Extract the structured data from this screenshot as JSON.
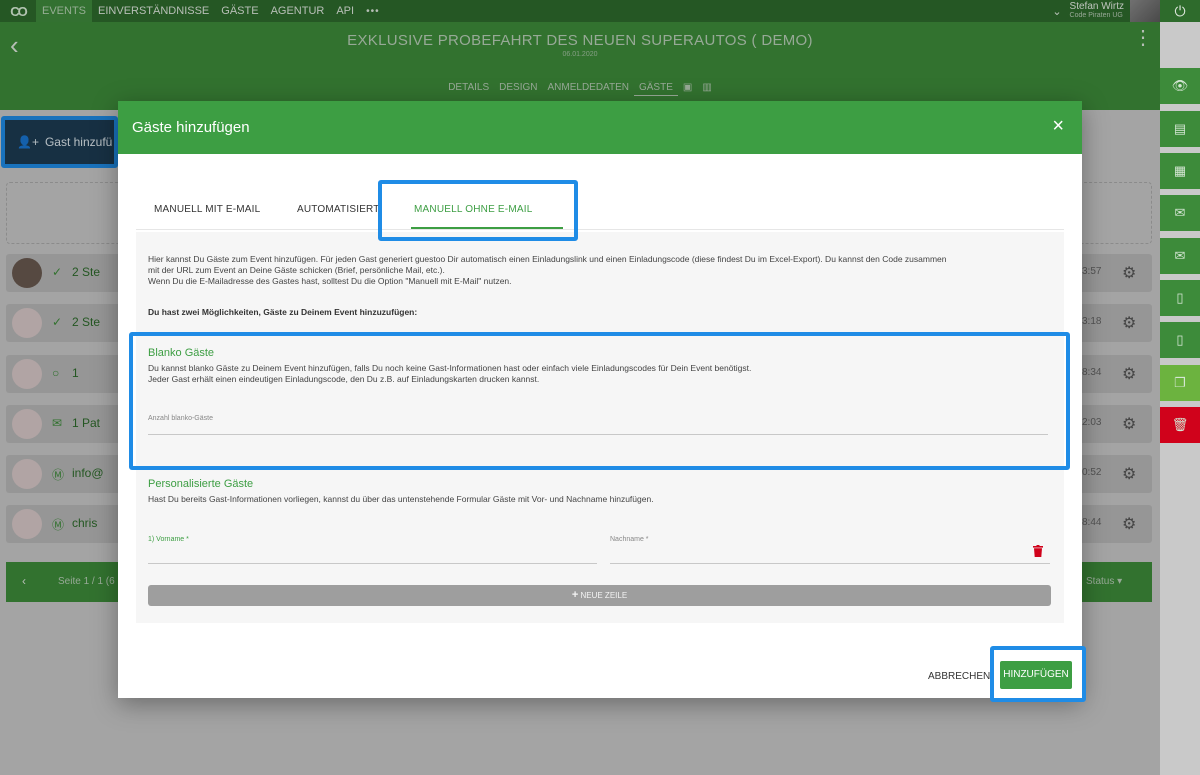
{
  "topnav": {
    "logo": "CO",
    "items": [
      "EVENTS",
      "EINVERSTÄNDNISSE",
      "GÄSTE",
      "AGENTUR",
      "API"
    ],
    "more": "•••",
    "user_name": "Stefan Wirtz",
    "user_company": "Code Piraten UG",
    "power": "⏻"
  },
  "header": {
    "title": "EXKLUSIVE PROBEFAHRT DES NEUEN SUPERAUTOS ( DEMO)",
    "date": "06.01.2020",
    "subnav": [
      "DETAILS",
      "DESIGN",
      "ANMELDEDATEN",
      "GÄSTE"
    ]
  },
  "background": {
    "add_guest_label": "Gast hinzufü",
    "rows": [
      {
        "status": "✓",
        "guests": "2 Ste",
        "time": "3:57"
      },
      {
        "status": "✓",
        "guests": "2 Ste",
        "time": "3:18"
      },
      {
        "status": "○",
        "guests": "1",
        "time": "8:34"
      },
      {
        "status": "✉",
        "guests": "1 Pat",
        "time": "2:03"
      },
      {
        "status": "Ⓜ",
        "guests": "info@",
        "time": "0:52"
      },
      {
        "status": "Ⓜ",
        "guests": "chris",
        "time": "8:44"
      }
    ],
    "pager_text": "Seite 1 / 1 (6",
    "status_label": "Status"
  },
  "modal": {
    "title": "Gäste hinzufügen",
    "close": "×",
    "tabs": [
      "MANUELL MIT E-MAIL",
      "AUTOMATISIERT",
      "MANUELL OHNE E-MAIL"
    ],
    "active_tab": 2,
    "intro_lines": [
      "Hier kannst Du Gäste zum Event hinzufügen. Für jeden Gast generiert guestoo Dir automatisch einen Einladungslink und einen Einladungscode (diese findest Du im Excel-Export). Du kannst den Code zusammen",
      "mit der URL zum Event an Deine Gäste schicken (Brief, persönliche Mail, etc.).",
      "Wenn Du die E-Mailadresse des Gastes hast, solltest Du die Option \"Manuell mit E-Mail\" nutzen."
    ],
    "intro_bold": "Du hast zwei Möglichkeiten, Gäste zu Deinem Event hinzuzufügen:",
    "blank": {
      "title": "Blanko Gäste",
      "desc_lines": [
        "Du kannst blanko Gäste zu Deinem Event hinzufügen, falls Du noch keine Gast-Informationen hast oder einfach viele Einladungscodes für Dein Event benötigst.",
        "Jeder Gast erhält einen eindeutigen Einladungscode, den Du z.B. auf Einladungskarten drucken kannst."
      ],
      "input_label": "Anzahl blanko-Gäste",
      "input_value": ""
    },
    "personal": {
      "title": "Personalisierte Gäste",
      "desc": "Hast Du bereits Gast-Informationen vorliegen, kannst du über das untenstehende Formular Gäste mit Vor- und Nachname hinzufügen.",
      "firstname_label": "1) Vorname *",
      "lastname_label": "Nachname *",
      "new_row": "NEUE ZEILE"
    },
    "cancel": "ABBRECHEN",
    "submit": "HINZUFÜGEN"
  },
  "colors": {
    "brand_green": "#3d9e43",
    "dark_green": "#2e6b2c",
    "highlight_blue": "#1f8ce6",
    "delete_red": "#d0021b"
  }
}
